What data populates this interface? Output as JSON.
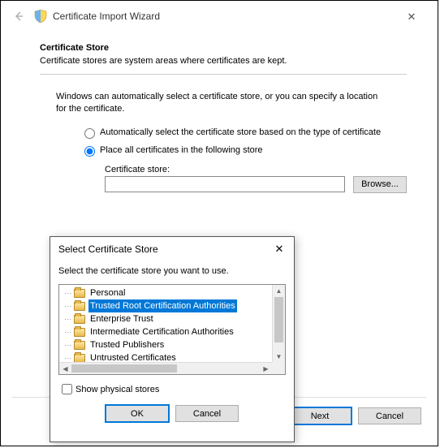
{
  "window": {
    "title": "Certificate Import Wizard",
    "close_label": "✕"
  },
  "page": {
    "heading": "Certificate Store",
    "subheading": "Certificate stores are system areas where certificates are kept.",
    "description": "Windows can automatically select a certificate store, or you can specify a location for the certificate.",
    "radio_auto": "Automatically select the certificate store based on the type of certificate",
    "radio_place": "Place all certificates in the following store",
    "store_label": "Certificate store:",
    "store_value": "",
    "browse_label": "Browse..."
  },
  "buttons": {
    "next": "Next",
    "cancel": "Cancel"
  },
  "dialog": {
    "title": "Select Certificate Store",
    "close_label": "✕",
    "instruction": "Select the certificate store you want to use.",
    "items": [
      "Personal",
      "Trusted Root Certification Authorities",
      "Enterprise Trust",
      "Intermediate Certification Authorities",
      "Trusted Publishers",
      "Untrusted Certificates"
    ],
    "selected_index": 1,
    "show_physical": "Show physical stores",
    "ok": "OK",
    "cancel": "Cancel"
  }
}
